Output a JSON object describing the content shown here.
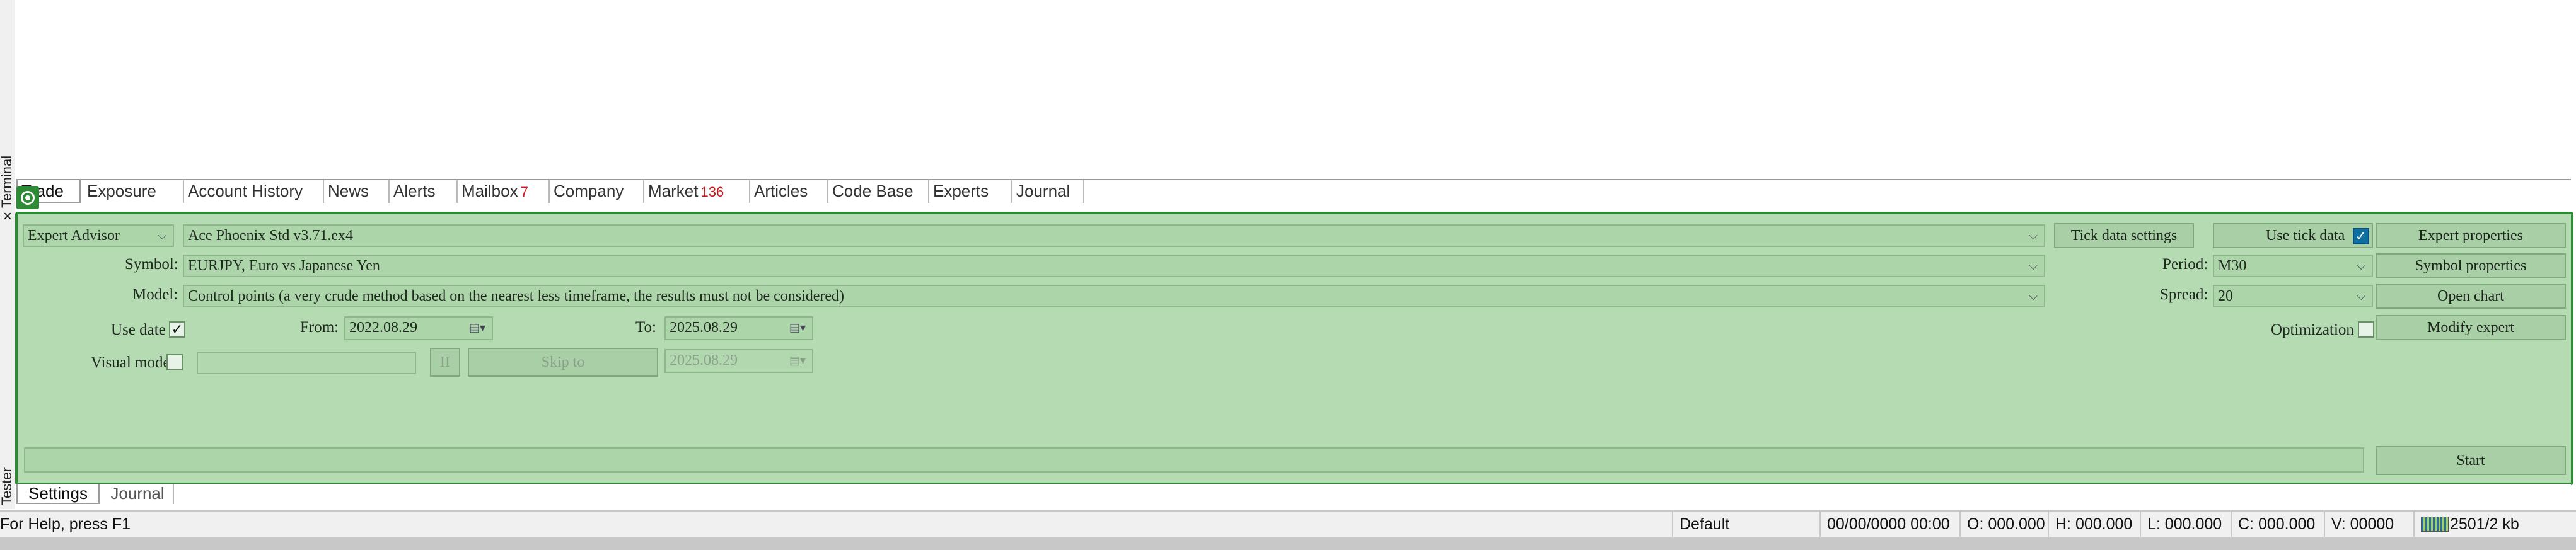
{
  "side": {
    "terminal": "Terminal",
    "tester": "Tester",
    "close": "×"
  },
  "terminal_tabs": [
    {
      "label": "Trade",
      "badge": ""
    },
    {
      "label": "Exposure",
      "badge": ""
    },
    {
      "label": "Account History",
      "badge": ""
    },
    {
      "label": "News",
      "badge": ""
    },
    {
      "label": "Alerts",
      "badge": ""
    },
    {
      "label": "Mailbox",
      "badge": "7"
    },
    {
      "label": "Company",
      "badge": ""
    },
    {
      "label": "Market",
      "badge": "136"
    },
    {
      "label": "Articles",
      "badge": ""
    },
    {
      "label": "Code Base",
      "badge": ""
    },
    {
      "label": "Experts",
      "badge": ""
    },
    {
      "label": "Journal",
      "badge": ""
    }
  ],
  "tester": {
    "program_type": "Expert Advisor",
    "expert_file": "Ace Phoenix Std v3.71.ex4",
    "tick_data_settings": "Tick data settings",
    "use_tick_data": "Use tick data",
    "expert_properties": "Expert properties",
    "symbol_label": "Symbol:",
    "symbol_value": "EURJPY, Euro vs Japanese Yen",
    "period_label": "Period:",
    "period_value": "M30",
    "symbol_properties": "Symbol properties",
    "model_label": "Model:",
    "model_value": "Control points (a very crude method based on the nearest less timeframe, the results must not be considered)",
    "spread_label": "Spread:",
    "spread_value": "20",
    "open_chart": "Open chart",
    "use_date_label": "Use date",
    "from_label": "From:",
    "from_value": "2022.08.29",
    "to_label": "To:",
    "to_value": "2025.08.29",
    "optimization_label": "Optimization",
    "modify_expert": "Modify expert",
    "visual_mode_label": "Visual mode",
    "pause_label": "II",
    "skip_to": "Skip to",
    "skip_date": "2025.08.29",
    "start": "Start"
  },
  "bottom_tabs": [
    {
      "label": "Settings"
    },
    {
      "label": "Journal"
    }
  ],
  "status": {
    "help": "For Help, press F1",
    "profile": "Default",
    "datetime": "00/00/0000 00:00",
    "open": "O: 000.000",
    "high": "H: 000.000",
    "low": "L: 000.000",
    "close": "C: 000.000",
    "volume": "V: 00000",
    "traffic": "2501/2 kb"
  },
  "colors": {
    "panel_bg": "#b5dbb3",
    "panel_border": "#2f8a36",
    "badge": "#d01818",
    "checkbox_blue": "#0e6fa0"
  },
  "icons": {
    "terminal_icon": "tester-target-icon",
    "calendar": "calendar-icon",
    "dropdown": "chevron-down-icon"
  }
}
